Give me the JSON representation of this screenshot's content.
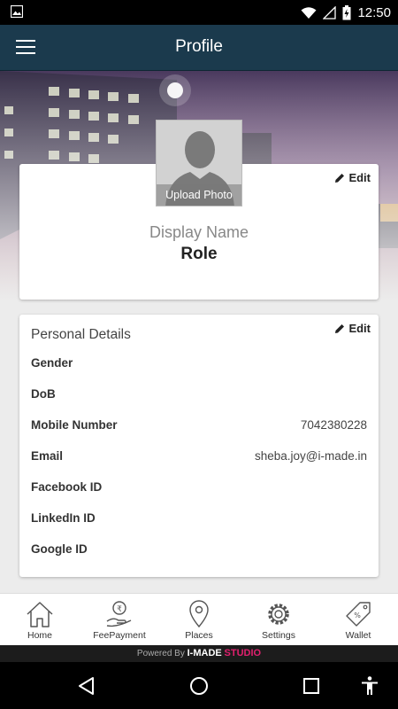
{
  "status_bar": {
    "time": "12:50"
  },
  "app_bar": {
    "title": "Profile"
  },
  "profile": {
    "photo_label": "Upload Photo",
    "edit_label": "Edit",
    "display_name": "Display Name",
    "role": "Role"
  },
  "details": {
    "title": "Personal Details",
    "edit_label": "Edit",
    "rows": [
      {
        "label": "Gender",
        "value": ""
      },
      {
        "label": "DoB",
        "value": ""
      },
      {
        "label": "Mobile Number",
        "value": "7042380228"
      },
      {
        "label": "Email",
        "value": "sheba.joy@i-made.in"
      },
      {
        "label": "Facebook ID",
        "value": ""
      },
      {
        "label": "LinkedIn ID",
        "value": ""
      },
      {
        "label": "Google ID",
        "value": ""
      }
    ]
  },
  "bottom_nav": [
    {
      "label": "Home",
      "icon": "home-icon"
    },
    {
      "label": "FeePayment",
      "icon": "fee-payment-icon"
    },
    {
      "label": "Places",
      "icon": "location-pin-icon"
    },
    {
      "label": "Settings",
      "icon": "gear-icon"
    },
    {
      "label": "Wallet",
      "icon": "wallet-tag-icon"
    }
  ],
  "footer": {
    "prefix": "Powered By",
    "brand": "I-MADE",
    "studio": "STUDIO"
  },
  "colors": {
    "app_bar": "#1b3a4d",
    "accent": "#e0206e"
  }
}
